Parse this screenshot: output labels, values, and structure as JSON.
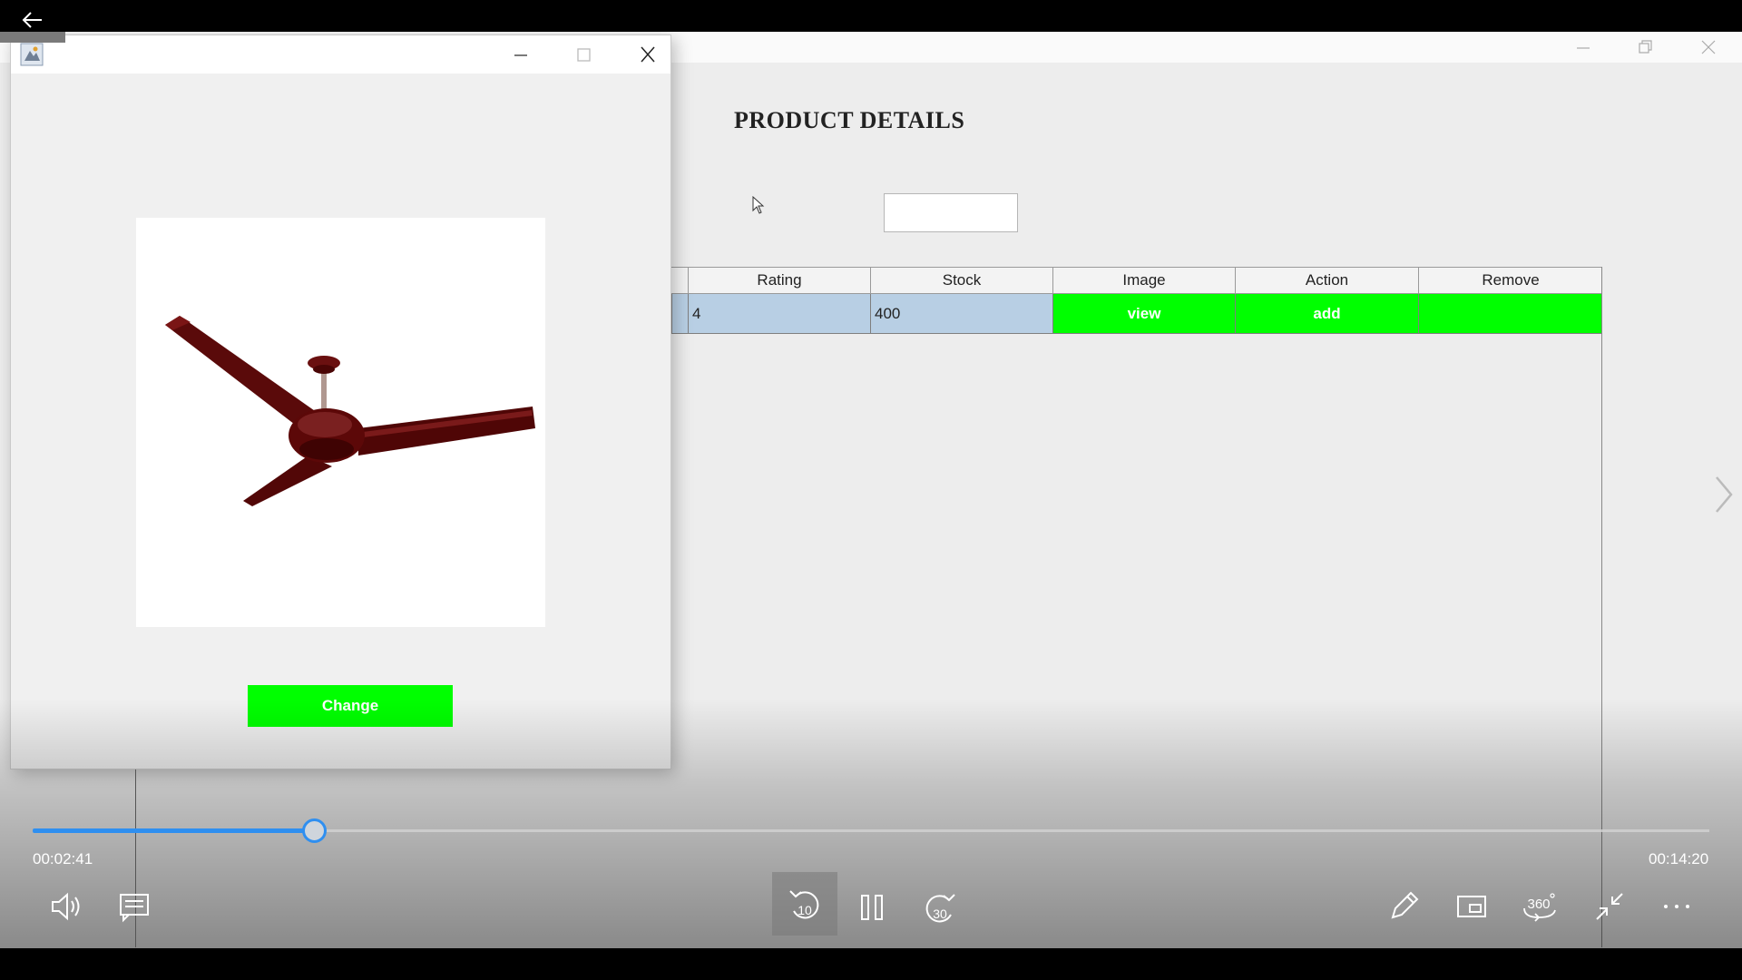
{
  "background_app": {
    "heading": "PRODUCT DETAILS",
    "search_value": "",
    "table": {
      "columns": [
        "Rating",
        "Stock",
        "Image",
        "Action",
        "Remove"
      ],
      "rows": [
        {
          "rating": "4",
          "stock": "400",
          "image": "view",
          "action": "add",
          "remove": ""
        }
      ]
    }
  },
  "dialog": {
    "image_alt": "ceiling-fan",
    "change_label": "Change"
  },
  "player": {
    "time_elapsed": "00:02:41",
    "time_total": "00:14:20",
    "progress": 0.168,
    "rewind_seconds": "10",
    "forward_seconds": "30",
    "view_360_label": "360",
    "accent_color": "#2f8ff0"
  },
  "colors": {
    "button_green": "#00ff00",
    "selected_row": "#b8cfe4"
  }
}
